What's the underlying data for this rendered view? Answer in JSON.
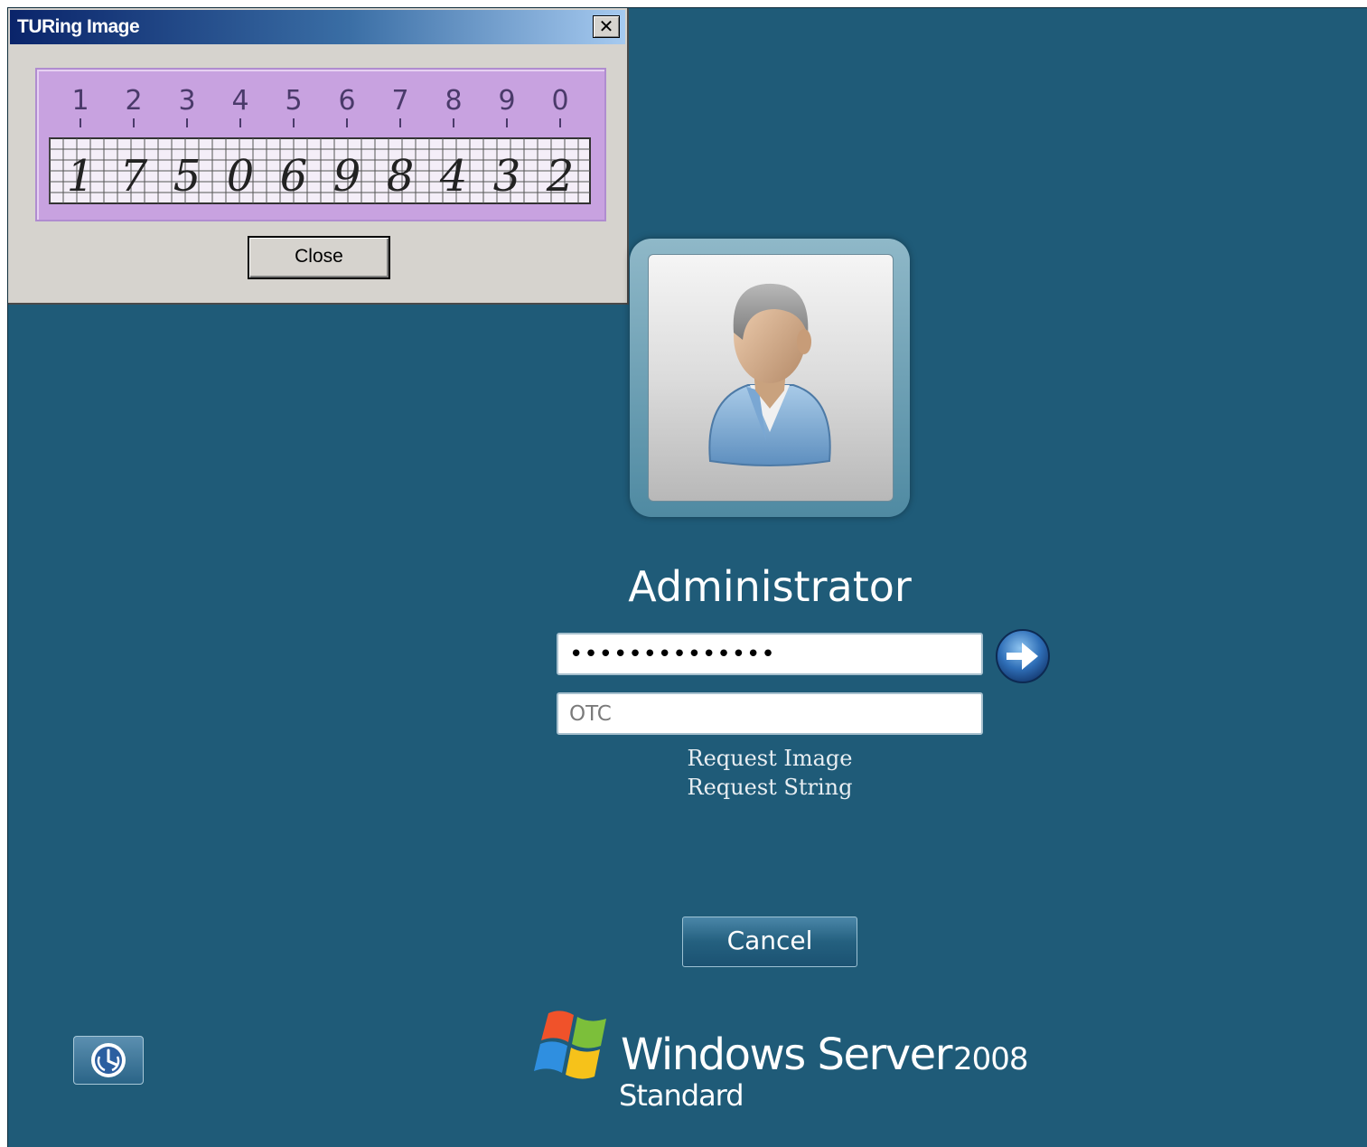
{
  "dialog": {
    "title": "TURing Image",
    "close_x": "✕",
    "close_label": "Close",
    "turing_image": {
      "reference_digits": [
        "1",
        "2",
        "3",
        "4",
        "5",
        "6",
        "7",
        "8",
        "9",
        "0"
      ],
      "code_digits": [
        "1",
        "7",
        "5",
        "0",
        "6",
        "9",
        "8",
        "4",
        "3",
        "2"
      ],
      "background_color": "#c8a2e0"
    }
  },
  "logon": {
    "username": "Administrator",
    "password_value": "••••••••••••••",
    "otc_placeholder": "OTC",
    "request_image_label": "Request Image",
    "request_string_label": "Request String",
    "cancel_label": "Cancel",
    "submit_icon": "arrow-right-icon",
    "avatar_icon": "user-icon"
  },
  "accessibility": {
    "icon": "ease-of-access-icon"
  },
  "branding": {
    "product": "Windows Server",
    "version": "2008",
    "edition": "Standard",
    "logo_icon": "windows-flag-icon"
  },
  "colors": {
    "desktop_background": "#1f5b78",
    "dialog_background": "#d6d3ce",
    "titlebar_start": "#0a246a",
    "titlebar_end": "#a6caf0",
    "turing_background": "#c8a2e0"
  }
}
